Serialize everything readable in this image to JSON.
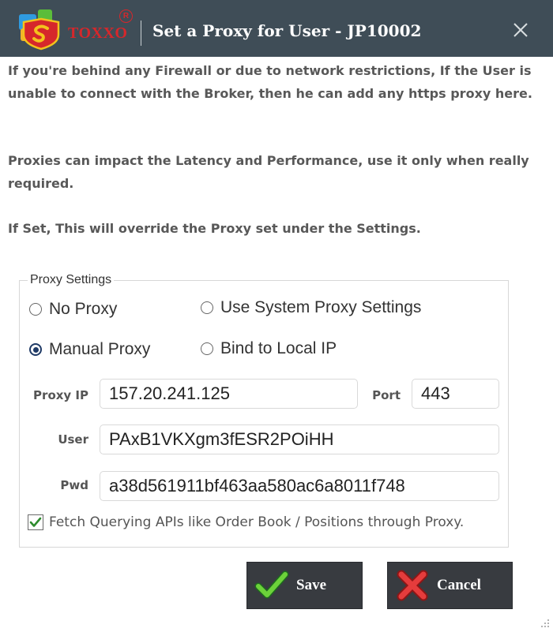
{
  "titlebar": {
    "brand": "TOXXO",
    "registered_mark": "R",
    "title": "Set a Proxy for User - JP10002",
    "icons": {
      "logo": "toxxo-shield-logo",
      "close": "close-icon"
    }
  },
  "info": {
    "paragraph1": "If you're behind any Firewall or due to network restrictions, If the User is unable to connect with the Broker, then he can add any https proxy here.",
    "paragraph2": "Proxies can impact the Latency and Performance, use it only when really required.",
    "paragraph3": "If Set, This will override the Proxy set under the Settings."
  },
  "proxy_settings": {
    "legend": "Proxy Settings",
    "options": [
      {
        "label": "No Proxy",
        "selected": false
      },
      {
        "label": "Use System Proxy Settings",
        "selected": false
      },
      {
        "label": "Manual Proxy",
        "selected": true
      },
      {
        "label": "Bind to Local IP",
        "selected": false
      }
    ],
    "proxy_ip": {
      "label": "Proxy IP",
      "value": "157.20.241.125"
    },
    "port": {
      "label": "Port",
      "value": "443"
    },
    "user": {
      "label": "User",
      "value": "PAxB1VKXgm3fESR2POiHH"
    },
    "pwd": {
      "label": "Pwd",
      "value": "a38d561911bf463aa580ac6a8011f748"
    },
    "fetch_via_proxy": {
      "label": "Fetch Querying APIs like Order Book / Positions through Proxy.",
      "checked": true
    }
  },
  "buttons": {
    "save": {
      "label": "Save",
      "icon": "checkmark-icon"
    },
    "cancel": {
      "label": "Cancel",
      "icon": "x-mark-icon"
    }
  },
  "colors": {
    "titlebar": "#3f4d57",
    "brand_red": "#d6272b",
    "button_bg": "#383b40",
    "radio_selected": "#1f3a66",
    "check_green": "#2e8b2e"
  }
}
